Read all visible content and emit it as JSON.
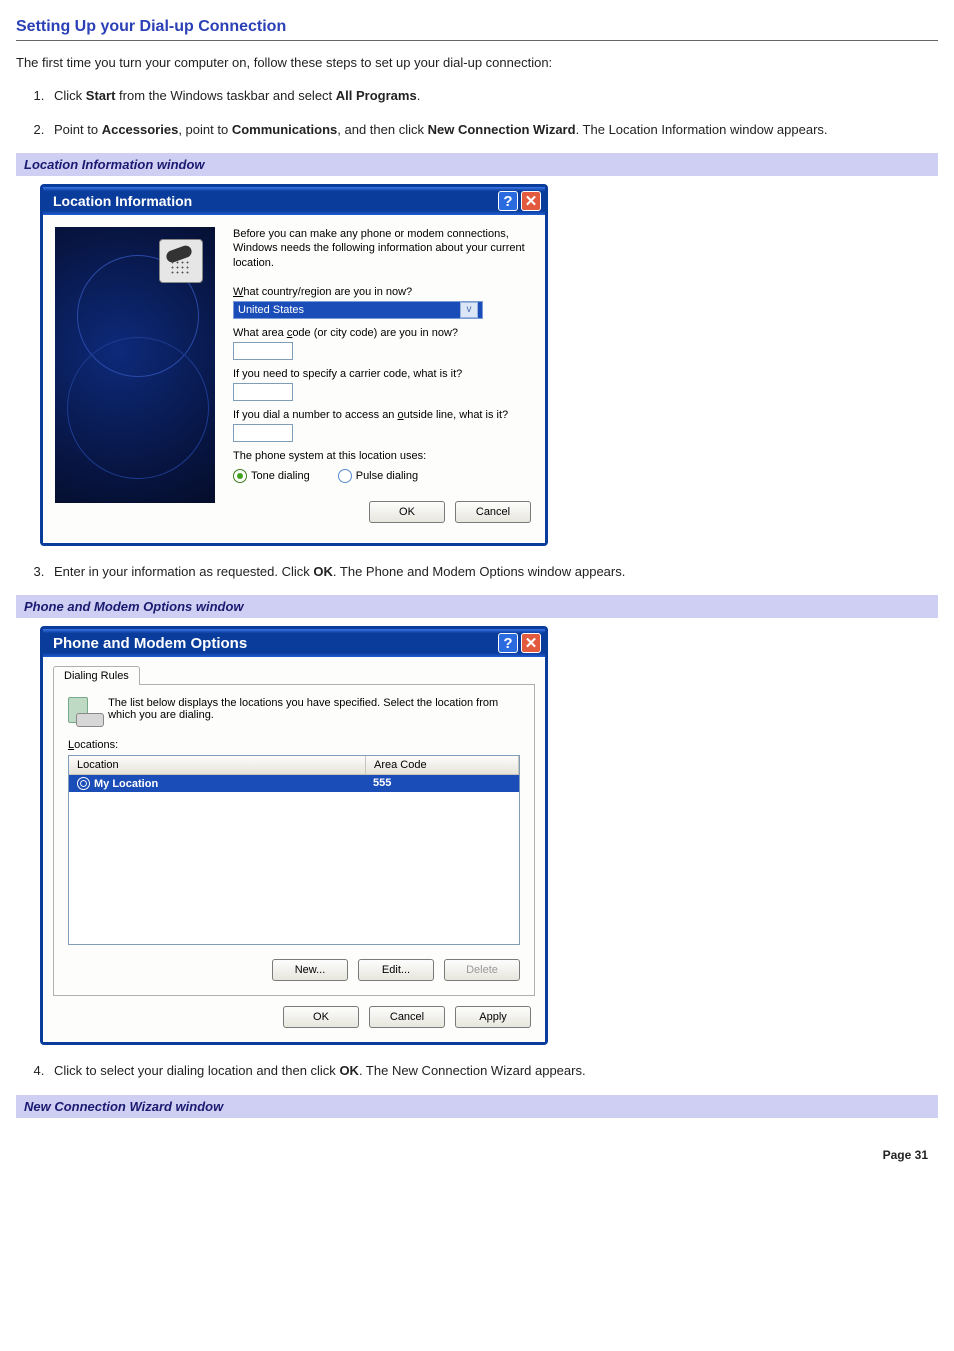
{
  "heading": "Setting Up your Dial-up Connection",
  "intro": "The first time you turn your computer on, follow these steps to set up your dial-up connection:",
  "steps": {
    "s1": {
      "pre": "Click ",
      "b1": "Start",
      "mid": " from the Windows taskbar and select ",
      "b2": "All Programs",
      "post": "."
    },
    "s2": {
      "pre": "Point to ",
      "b1": "Accessories",
      "mid1": ", point to ",
      "b2": "Communications",
      "mid2": ", and then click ",
      "b3": "New Connection Wizard",
      "post": ". The Location Information window appears."
    },
    "s3": {
      "pre": "Enter in your information as requested. Click ",
      "b1": "OK",
      "post": ". The Phone and Modem Options window appears."
    },
    "s4": {
      "pre": "Click to select your dialing location and then click ",
      "b1": "OK",
      "post": ". The New Connection Wizard appears."
    }
  },
  "caption1": "Location Information window",
  "caption2": "Phone and Modem Options window",
  "caption3": "New Connection Wizard window",
  "win1": {
    "title": "Location Information",
    "desc": "Before you can make any phone or modem connections, Windows needs the following information about your current location.",
    "q_country_pre": "W",
    "q_country_post": "hat country/region are you in now?",
    "country_value": "United States",
    "q_area_pre": "What area ",
    "q_area_u": "c",
    "q_area_post": "ode (or city code) are you in now?",
    "q_carrier": "If you need to specify a carrier code, what is it?",
    "q_outside_pre": "If you dial a number to access an ",
    "q_outside_u": "o",
    "q_outside_post": "utside line, what is it?",
    "phone_sys": "The phone system at this location uses:",
    "tone_u": "T",
    "tone_post": "one dialing",
    "pulse_u": "P",
    "pulse_post": "ulse dialing",
    "ok": "OK",
    "cancel": "Cancel"
  },
  "win2": {
    "title": "Phone and Modem Options",
    "tab": "Dialing Rules",
    "desc": "The list below displays the locations you have specified. Select the location from which you are dialing.",
    "loc_u": "L",
    "loc_post": "ocations:",
    "col_location": "Location",
    "col_area": "Area Code",
    "row_name": "My Location",
    "row_area": "555",
    "new_u": "N",
    "new_post": "ew...",
    "edit_u": "E",
    "edit_post": "dit...",
    "del_u": "D",
    "del_post": "elete",
    "ok": "OK",
    "cancel": "Cancel",
    "apply_u": "A",
    "apply_post": "pply"
  },
  "pagenum": "Page 31"
}
